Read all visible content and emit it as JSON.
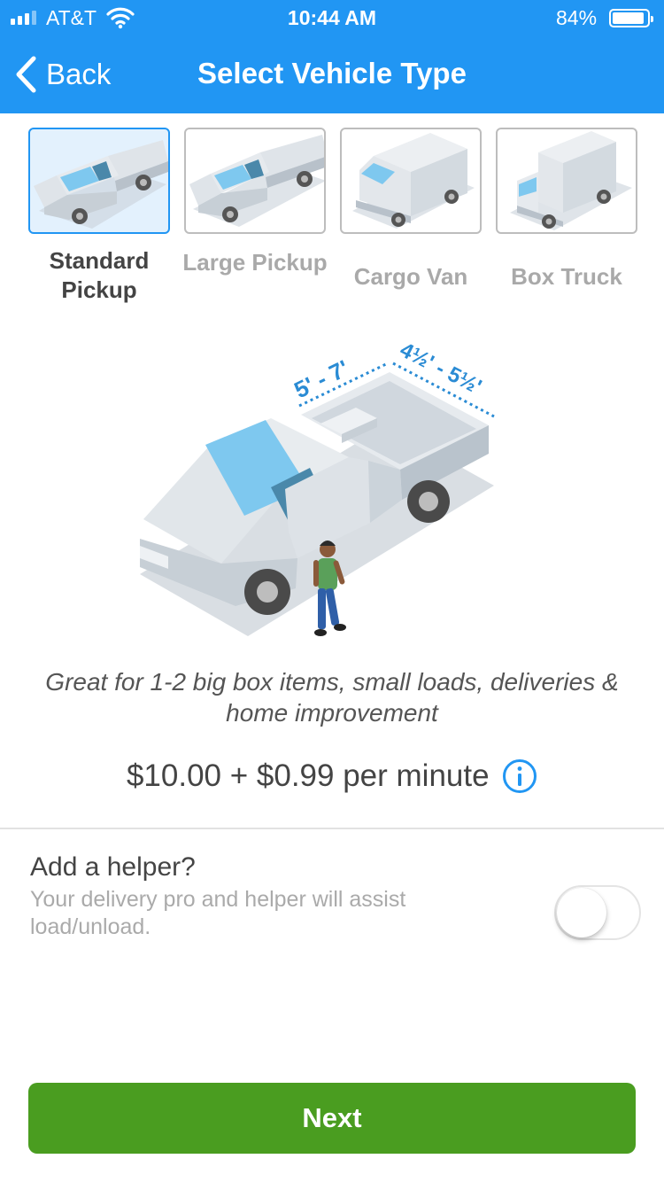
{
  "status_bar": {
    "carrier": "AT&T",
    "time": "10:44 AM",
    "battery_percent": "84%",
    "battery_level": 0.84,
    "icons": [
      "signal-icon",
      "wifi-icon",
      "battery-icon"
    ]
  },
  "nav": {
    "back_label": "Back",
    "title": "Select Vehicle Type",
    "background_color": "#2196f3"
  },
  "vehicles": [
    {
      "label": "Standard Pickup",
      "selected": true
    },
    {
      "label": "Large Pickup",
      "selected": false
    },
    {
      "label": "Cargo Van",
      "selected": false
    },
    {
      "label": "Box Truck",
      "selected": false
    }
  ],
  "hero": {
    "bed_length": "5' - 7'",
    "bed_width": "4½' - 5½'"
  },
  "description": "Great for 1-2 big box items, small loads, deliveries & home improvement",
  "price": "$10.00 + $0.99 per minute",
  "helper": {
    "title": "Add a helper?",
    "subtitle": "Your delivery pro and helper will assist load/unload.",
    "enabled": false
  },
  "next_label": "Next",
  "colors": {
    "accent": "#2196f3",
    "primary_button": "#4a9d20"
  }
}
